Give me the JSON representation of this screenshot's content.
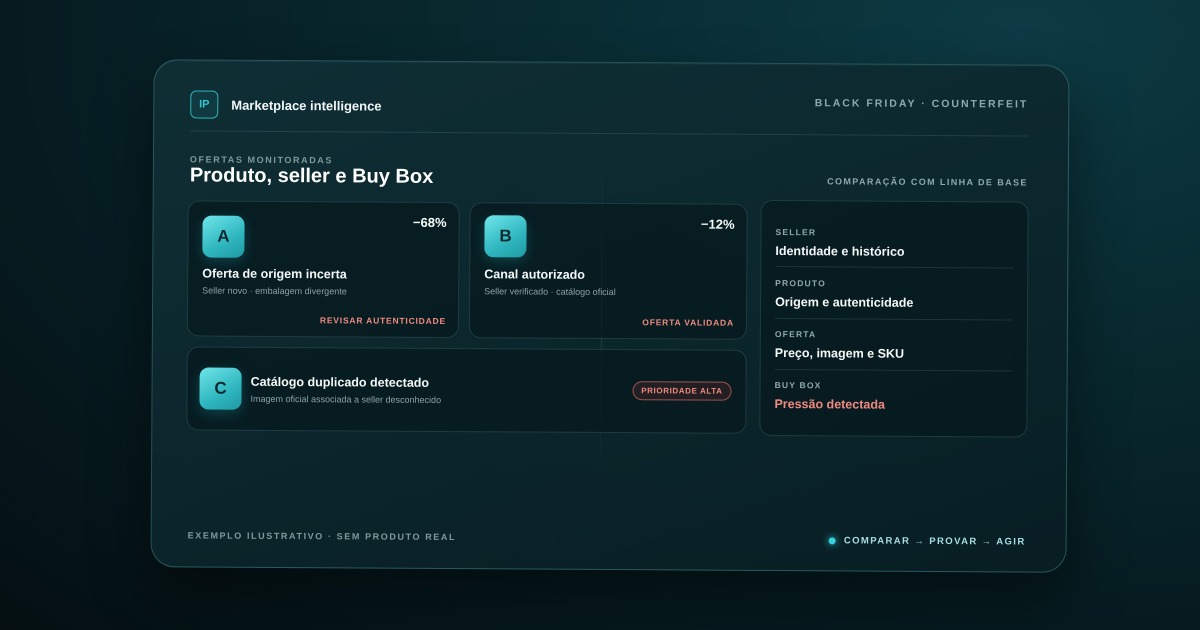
{
  "header": {
    "logo": "IP",
    "app_title": "Marketplace intelligence",
    "tag": "BLACK FRIDAY · COUNTERFEIT"
  },
  "section": {
    "eyebrow": "OFERTAS MONITORADAS",
    "title": "Produto, seller e Buy Box",
    "baseline": "COMPARAÇÃO COM LINHA DE BASE"
  },
  "cards": [
    {
      "letter": "A",
      "delta": "−68%",
      "title": "Oferta de origem incerta",
      "subtitle": "Seller novo · embalagem divergente",
      "status": "REVISAR AUTENTICIDADE"
    },
    {
      "letter": "B",
      "delta": "−12%",
      "title": "Canal autorizado",
      "subtitle": "Seller verificado · catálogo oficial",
      "status": "OFERTA VALIDADA"
    },
    {
      "letter": "C",
      "title": "Catálogo duplicado detectado",
      "subtitle": "Imagem oficial associada a seller desconhecido",
      "priority": "PRIORIDADE ALTA"
    }
  ],
  "side_panel": [
    {
      "label": "SELLER",
      "value": "Identidade e histórico"
    },
    {
      "label": "PRODUTO",
      "value": "Origem e autenticidade"
    },
    {
      "label": "OFERTA",
      "value": "Preço, imagem e SKU"
    },
    {
      "label": "BUY BOX",
      "value": "Pressão detectada"
    }
  ],
  "footer": {
    "note": "EXEMPLO ILUSTRATIVO · SEM PRODUTO REAL",
    "flow": "COMPARAR → PROVAR → AGIR"
  },
  "colors": {
    "accent": "#35d3db",
    "alert": "#ef8a80"
  }
}
